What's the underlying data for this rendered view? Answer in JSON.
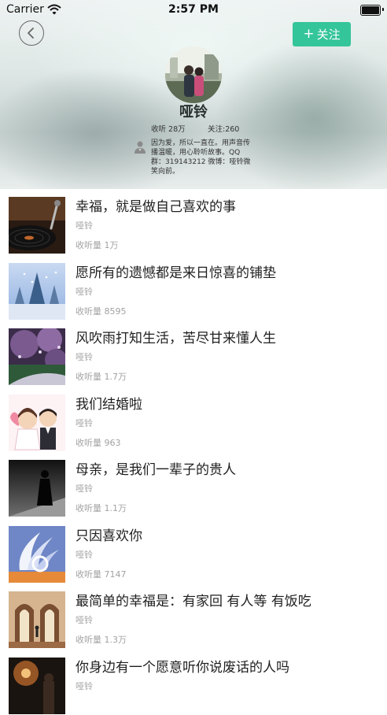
{
  "status_bar": {
    "carrier": "Carrier",
    "time": "2:57 PM",
    "wifi_icon": "wifi-icon",
    "battery_icon": "battery-icon"
  },
  "header": {
    "back_icon": "chevron-left-icon",
    "follow_icon": "plus-icon",
    "follow_label": "关注",
    "follow_color": "#34c59a",
    "name": "哑铃",
    "listens": "收听 28万",
    "following": "关注:260",
    "bio_icon": "person-badge-icon",
    "bio": "因为爱，所以一直在。用声音传播温暖，用心聆听故事。QQ群：319143212 微博：哑铃微笑向前。"
  },
  "tracks": [
    {
      "title": "幸福，就是做自己喜欢的事",
      "author": "哑铃",
      "plays": "收听量 1万"
    },
    {
      "title": "愿所有的遗憾都是来日惊喜的铺垫",
      "author": "哑铃",
      "plays": "收听量 8595"
    },
    {
      "title": "风吹雨打知生活，苦尽甘来懂人生",
      "author": "哑铃",
      "plays": "收听量 1.7万"
    },
    {
      "title": "我们结婚啦",
      "author": "哑铃",
      "plays": "收听量 963"
    },
    {
      "title": "母亲，是我们一辈子的贵人",
      "author": "哑铃",
      "plays": "收听量 1.1万"
    },
    {
      "title": "只因喜欢你",
      "author": "哑铃",
      "plays": "收听量 7147"
    },
    {
      "title": "最简单的幸福是：有家回 有人等 有饭吃",
      "author": "哑铃",
      "plays": "收听量 1.3万"
    },
    {
      "title": "你身边有一个愿意听你说废话的人吗",
      "author": "哑铃",
      "plays": ""
    }
  ]
}
